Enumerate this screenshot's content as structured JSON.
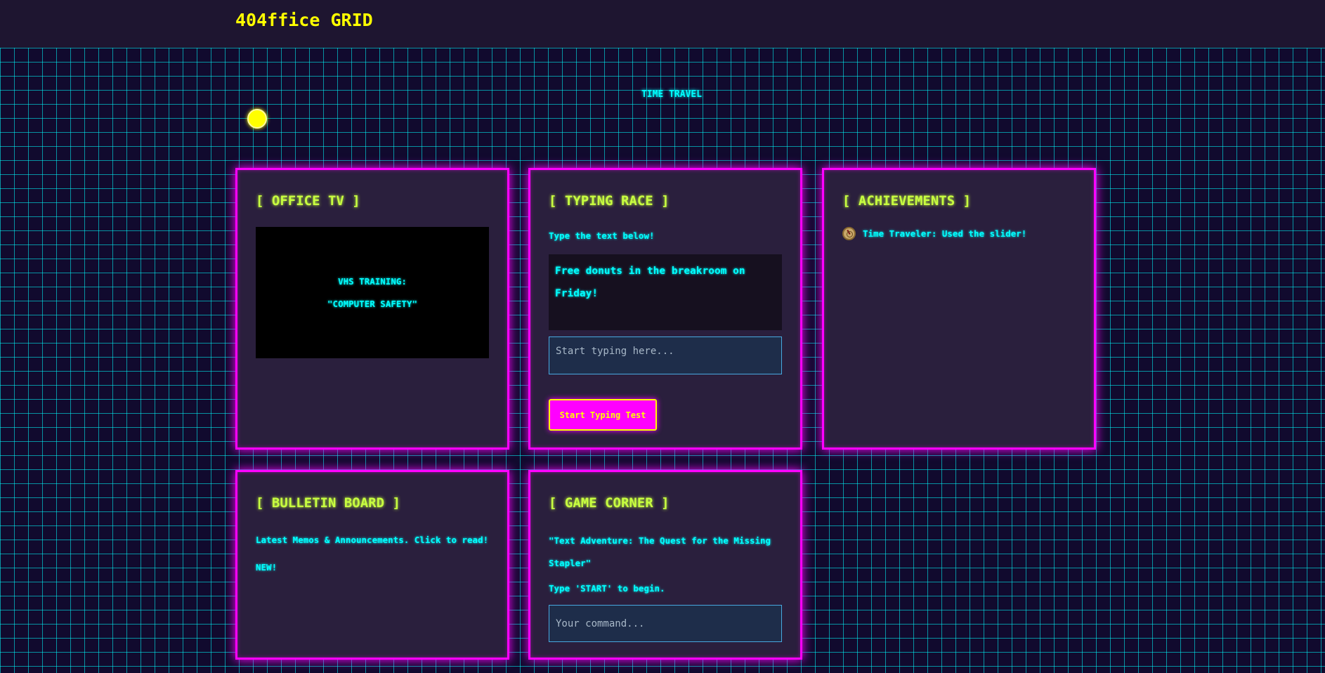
{
  "header": {
    "brand": "404ffice GRID"
  },
  "slider": {
    "label": "TIME TRAVEL"
  },
  "cards": {
    "office_tv": {
      "title": "[ OFFICE TV ]",
      "screen_line1": "VHS TRAINING:",
      "screen_line2": "\"COMPUTER SAFETY\""
    },
    "typing_race": {
      "title": "[ TYPING RACE ]",
      "instruction": "Type the text below!",
      "target_text": "Free donuts in the breakroom on Friday!",
      "input_placeholder": "Start typing here...",
      "button_label": "Start Typing Test"
    },
    "achievements": {
      "title": "[ ACHIEVEMENTS ]",
      "items": [
        {
          "icon": "compass-icon",
          "label": "Time Traveler: Used the slider!"
        }
      ]
    },
    "bulletin_board": {
      "title": "[ BULLETIN BOARD ]",
      "description": "Latest Memos & Announcements. Click to read!",
      "badge": "NEW!"
    },
    "game_corner": {
      "title": "[ GAME CORNER ]",
      "game_title": "\"Text Adventure: The Quest for the Missing Stapler\"",
      "instruction": "Type 'START' to begin.",
      "input_placeholder": "Your command..."
    }
  },
  "colors": {
    "accent_magenta": "#ff00ff",
    "accent_cyan": "#00ffff",
    "accent_yellow": "#ffff00",
    "title_green": "#c8ff40",
    "card_bg": "#2a1f3d",
    "page_bg": "#110a2e"
  }
}
